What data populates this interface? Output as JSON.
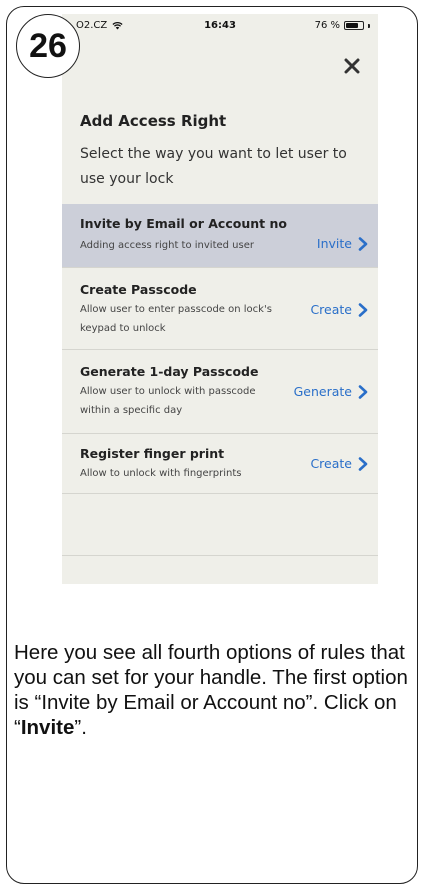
{
  "step_number": "26",
  "status_bar": {
    "carrier": "O2.CZ",
    "time": "16:43",
    "battery_text": "76 %",
    "battery_level": 0.76
  },
  "screen": {
    "close_icon": "close-icon",
    "title": "Add Access Right",
    "subtitle": "Select the way you want to let user to use your lock",
    "options": [
      {
        "title": "Invite by Email or Account no",
        "description": "Adding access right to invited user",
        "action": "Invite",
        "highlighted": true
      },
      {
        "title": "Create Passcode",
        "description": "Allow user to enter passcode on lock's keypad to unlock",
        "action": "Create",
        "highlighted": false
      },
      {
        "title": "Generate 1-day Passcode",
        "description": "Allow user to unlock with passcode within a specific day",
        "action": "Generate",
        "highlighted": false
      },
      {
        "title": "Register finger print",
        "description": "Allow to unlock with fingerprints",
        "action": "Create",
        "highlighted": false
      }
    ],
    "accent_color": "#2a6fc9",
    "highlight_color": "#cccfd9"
  },
  "caption": {
    "part1": "Here you see all fourth options of rules that you can set for your handle. The first option is “Invite by Email or Account no”. Click on “",
    "bold": "Invite",
    "part2": "”."
  }
}
